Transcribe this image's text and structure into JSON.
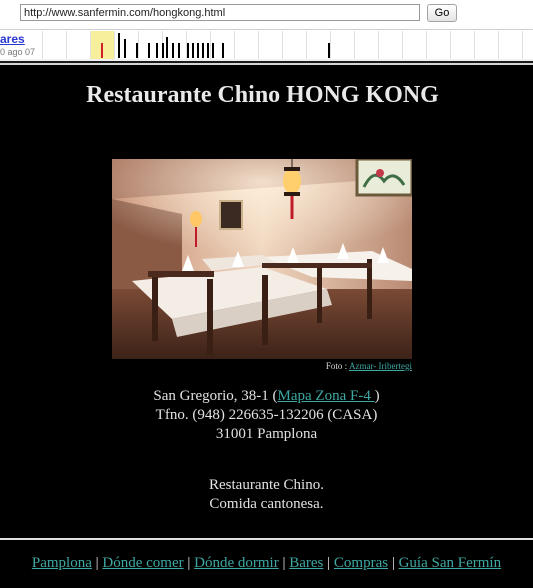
{
  "toolbar": {
    "url": "http://www.sanfermin.com/hongkong.html",
    "go_label": "Go",
    "capture_link": "ares",
    "capture_date": "0 ago 07"
  },
  "page": {
    "title": "Restaurante Chino HONG KONG",
    "photo_credit_prefix": "Foto :",
    "photo_credit_link": "Azmar- Iribertegi",
    "address_pre": "San Gregorio, 38-1 (",
    "address_map_link": "Mapa Zona F-4 ",
    "address_post": ")",
    "phone": "Tfno. (948) 226635-132206 (CASA)",
    "city": "31001 Pamplona",
    "desc_line1": "Restaurante Chino.",
    "desc_line2": "Comida cantonesa."
  },
  "footer": {
    "links": [
      "Pamplona",
      "Dónde comer",
      "Dónde dormir",
      "Bares",
      "Compras",
      "Guía San Fermín"
    ],
    "separator": "|"
  },
  "colors": {
    "background": "#000000",
    "link": "#3fa8a3",
    "text": "#e2e2e2"
  }
}
